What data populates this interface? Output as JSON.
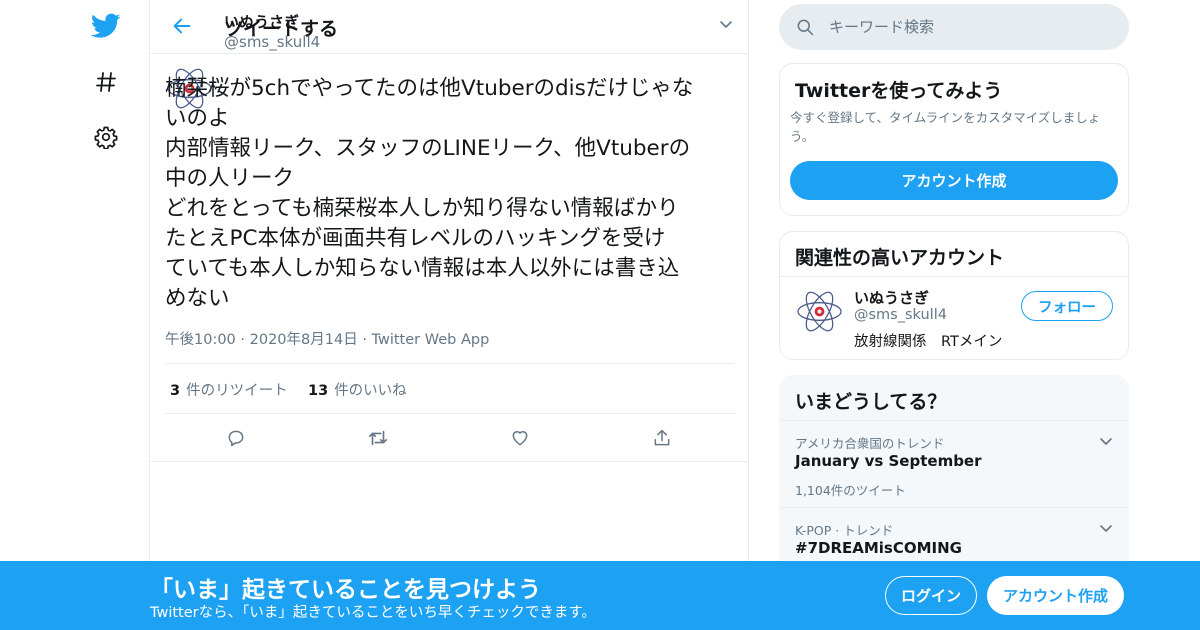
{
  "colors": {
    "accent": "#1da1f2",
    "text": "#14171a",
    "secondary": "#657786",
    "border": "#e6ecf0",
    "trend_bg": "#f5f8fa"
  },
  "nav": {
    "icons": [
      "twitter-logo-icon",
      "hashtag-icon",
      "gear-icon"
    ]
  },
  "header": {
    "title": "ツイートする"
  },
  "tweet": {
    "author_name": "いぬうさぎ",
    "author_handle": "@sms_skull4",
    "text_lines": [
      "楠栞桜が5chでやってたのは他Vtuberのdisだけじゃな",
      "いのよ",
      "内部情報リーク、スタッフのLINEリーク、他Vtuberの",
      "中の人リーク",
      "どれをとっても楠栞桜本人しか知り得ない情報ばかり",
      "たとえPC本体が画面共有レベルのハッキングを受け",
      "ていても本人しか知らない情報は本人以外には書き込",
      "めない"
    ],
    "time": "午後10:00",
    "date": "2020年8月14日",
    "source": "Twitter Web App",
    "separator": "·",
    "retweets_count": "3",
    "retweets_label": "件のリツイート",
    "likes_count": "13",
    "likes_label": "件のいいね"
  },
  "search": {
    "placeholder": "キーワード検索"
  },
  "signup_card": {
    "title": "Twitterを使ってみよう",
    "description": "今すぐ登録して、タイムラインをカスタマイズしましょう。",
    "button": "アカウント作成"
  },
  "related": {
    "title": "関連性の高いアカウント",
    "name": "いぬうさぎ",
    "handle": "@sms_skull4",
    "bio": "放射線関係　RTメイン",
    "follow_button": "フォロー"
  },
  "trends": {
    "title": "いまどうしてる？",
    "items": [
      {
        "context": "アメリカ合衆国のトレンド",
        "name": "January vs September",
        "count": "1,104件のツイート"
      },
      {
        "context": "K-POP · トレンド",
        "name": "#7DREAMisCOMING",
        "count": ""
      }
    ]
  },
  "bottom_bar": {
    "title": "「いま」起きていることを見つけよう",
    "subtitle": "Twitterなら、「いま」起きていることをいち早くチェックできます。",
    "login": "ログイン",
    "signup": "アカウント作成"
  }
}
